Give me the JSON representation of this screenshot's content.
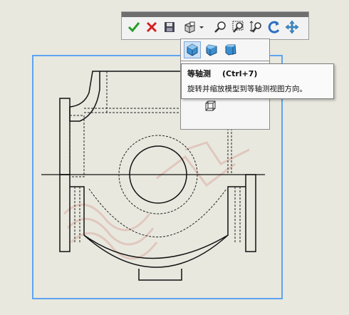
{
  "toolbar": {
    "buttons": [
      {
        "name": "ok-button",
        "icon": "checkmark-icon"
      },
      {
        "name": "cancel-button",
        "icon": "x-icon"
      },
      {
        "name": "save-view-button",
        "icon": "save-icon"
      },
      {
        "name": "view-orientation-button",
        "icon": "view-orientation-icon"
      },
      {
        "name": "zoom-to-fit-button",
        "icon": "zoom-fit-icon"
      },
      {
        "name": "zoom-to-area-button",
        "icon": "zoom-area-icon"
      },
      {
        "name": "zoom-in-out-button",
        "icon": "zoom-in-out-icon"
      },
      {
        "name": "rotate-button",
        "icon": "rotate-icon"
      },
      {
        "name": "pan-button",
        "icon": "pan-icon"
      }
    ]
  },
  "flyout": {
    "views": [
      {
        "name": "isometric-view-button",
        "icon": "isometric-cube-icon"
      },
      {
        "name": "trimetric-view-button",
        "icon": "trimetric-cube-icon"
      },
      {
        "name": "dimetric-view-button",
        "icon": "dimetric-cube-icon"
      }
    ]
  },
  "tooltip": {
    "title": "等轴测",
    "shortcut": "(Ctrl+7)",
    "description": "旋转并缩放模型到等轴测视图方向。"
  },
  "colors": {
    "background": "#e8e8df",
    "selection": "#5da4f0",
    "ok_green": "#2a9d2a",
    "cancel_red": "#d42020",
    "cube_blue": "#3b8fd0"
  }
}
